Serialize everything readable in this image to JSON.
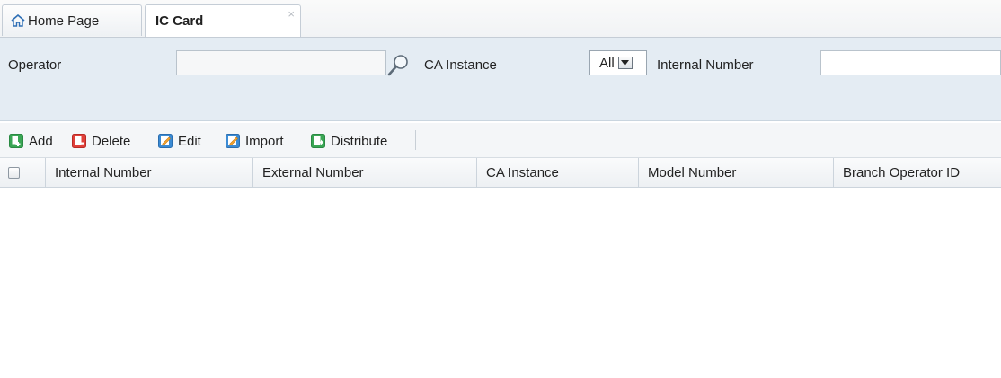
{
  "tabs": [
    {
      "label": "Home Page",
      "icon": "home-icon"
    },
    {
      "label": "IC Card",
      "active": true,
      "close": "×"
    }
  ],
  "search": {
    "operator_label": "Operator",
    "operator_value": "",
    "ca_instance_label": "CA Instance",
    "ca_instance_selected": "All",
    "internal_number_label": "Internal Number",
    "internal_number_value": ""
  },
  "toolbar": {
    "add_label": "Add",
    "delete_label": "Delete",
    "edit_label": "Edit",
    "import_label": "Import",
    "distribute_label": "Distribute"
  },
  "table": {
    "columns": [
      "Internal Number",
      "External Number",
      "CA Instance",
      "Model Number",
      "Branch Operator ID"
    ],
    "rows": []
  },
  "colors": {
    "panel_bg": "#e4ecf3",
    "add_green": "#3aa655",
    "delete_red": "#e0403a",
    "edit_blue": "#3b8bd4"
  }
}
